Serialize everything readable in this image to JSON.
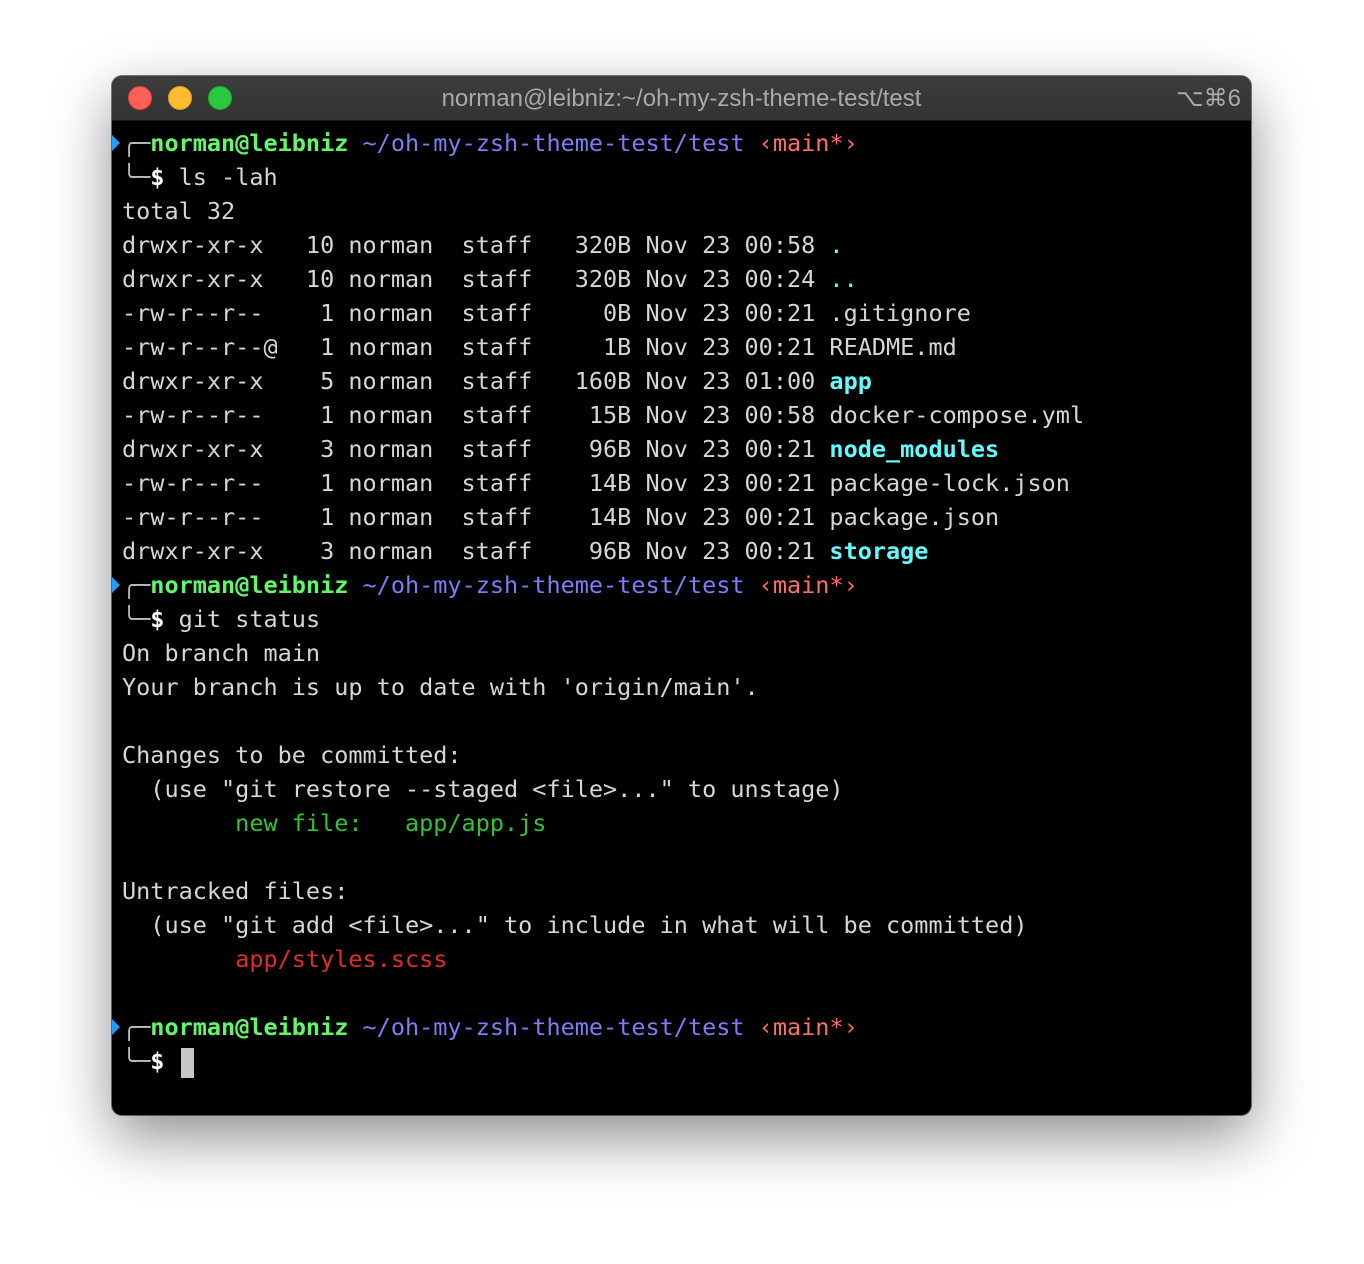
{
  "window": {
    "title": "norman@leibniz:~/oh-my-zsh-theme-test/test",
    "shortcut": "⌥⌘6"
  },
  "prompt": {
    "corner_top": "╭─",
    "corner_bottom": "╰─",
    "user_host": "norman@leibniz",
    "path": "~/oh-my-zsh-theme-test/test",
    "branch": "‹main*›",
    "symbol": "$"
  },
  "blocks": {
    "ls": {
      "command": "ls -lah",
      "total": "total 32",
      "rows": [
        {
          "perms": "drwxr-xr-x ",
          "links": "10",
          "owner": "norman",
          "group": "staff",
          "size": "320B",
          "date": "Nov 23 00:58",
          "name": ".",
          "kind": "dotdir"
        },
        {
          "perms": "drwxr-xr-x ",
          "links": "10",
          "owner": "norman",
          "group": "staff",
          "size": "320B",
          "date": "Nov 23 00:24",
          "name": "..",
          "kind": "dotdir"
        },
        {
          "perms": "-rw-r--r-- ",
          "links": "1",
          "owner": "norman",
          "group": "staff",
          "size": "0B",
          "date": "Nov 23 00:21",
          "name": ".gitignore",
          "kind": "file"
        },
        {
          "perms": "-rw-r--r--@",
          "links": "1",
          "owner": "norman",
          "group": "staff",
          "size": "1B",
          "date": "Nov 23 00:21",
          "name": "README.md",
          "kind": "file"
        },
        {
          "perms": "drwxr-xr-x ",
          "links": "5",
          "owner": "norman",
          "group": "staff",
          "size": "160B",
          "date": "Nov 23 01:00",
          "name": "app",
          "kind": "dir"
        },
        {
          "perms": "-rw-r--r-- ",
          "links": "1",
          "owner": "norman",
          "group": "staff",
          "size": "15B",
          "date": "Nov 23 00:58",
          "name": "docker-compose.yml",
          "kind": "file"
        },
        {
          "perms": "drwxr-xr-x ",
          "links": "3",
          "owner": "norman",
          "group": "staff",
          "size": "96B",
          "date": "Nov 23 00:21",
          "name": "node_modules",
          "kind": "dir"
        },
        {
          "perms": "-rw-r--r-- ",
          "links": "1",
          "owner": "norman",
          "group": "staff",
          "size": "14B",
          "date": "Nov 23 00:21",
          "name": "package-lock.json",
          "kind": "file"
        },
        {
          "perms": "-rw-r--r-- ",
          "links": "1",
          "owner": "norman",
          "group": "staff",
          "size": "14B",
          "date": "Nov 23 00:21",
          "name": "package.json",
          "kind": "file"
        },
        {
          "perms": "drwxr-xr-x ",
          "links": "3",
          "owner": "norman",
          "group": "staff",
          "size": "96B",
          "date": "Nov 23 00:21",
          "name": "storage",
          "kind": "dir"
        }
      ]
    },
    "git": {
      "command": "git status",
      "on_branch": "On branch main",
      "up_to_date": "Your branch is up to date with 'origin/main'.",
      "staged_header": "Changes to be committed:",
      "staged_hint": "  (use \"git restore --staged <file>...\" to unstage)",
      "staged_label": "        new file:   ",
      "staged_file": "app/app.js",
      "untracked_header": "Untracked files:",
      "untracked_hint": "  (use \"git add <file>...\" to include in what will be committed)",
      "untracked_indent": "        ",
      "untracked_file": "app/styles.scss"
    }
  },
  "colors": {
    "user": "#5ff967",
    "path": "#7e7cf6",
    "branch": "#ff6e67",
    "directory": "#5ffdff",
    "staged": "#2ec52e",
    "untracked": "#e02b2b"
  }
}
